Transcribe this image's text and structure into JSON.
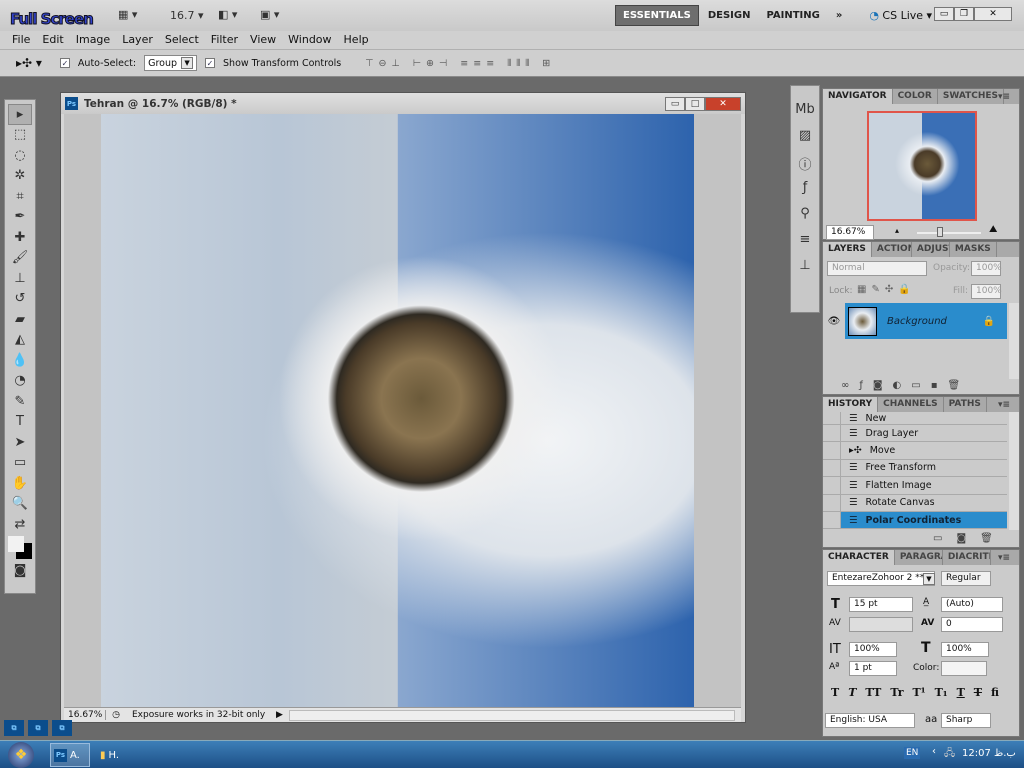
{
  "appbar": {
    "overlay_text": "Full Screen",
    "zoom": "16.7",
    "workspaces": [
      "ESSENTIALS",
      "DESIGN",
      "PAINTING"
    ],
    "more": "»",
    "cslive": "CS Live"
  },
  "menu": [
    "File",
    "Edit",
    "Image",
    "Layer",
    "Select",
    "Filter",
    "View",
    "Window",
    "Help"
  ],
  "options": {
    "auto_select_label": "Auto-Select:",
    "auto_select_value": "Group",
    "show_transform": "Show Transform Controls"
  },
  "document": {
    "title": "Tehran @ 16.7% (RGB/8) *",
    "zoom": "16.67%",
    "status": "Exposure works in 32-bit only"
  },
  "navigator": {
    "tabs": [
      "NAVIGATOR",
      "COLOR",
      "SWATCHES"
    ],
    "zoom": "16.67%"
  },
  "layers": {
    "tabs": [
      "LAYERS",
      "ACTIONS",
      "ADJUSTMENTS",
      "MASKS"
    ],
    "blend": "Normal",
    "opacity_label": "Opacity:",
    "opacity": "100%",
    "lock_label": "Lock:",
    "fill_label": "Fill:",
    "fill": "100%",
    "items": [
      {
        "name": "Background"
      }
    ]
  },
  "history": {
    "tabs": [
      "HISTORY",
      "CHANNELS",
      "PATHS"
    ],
    "items": [
      "New",
      "Drag Layer",
      "Move",
      "Free Transform",
      "Flatten Image",
      "Rotate Canvas",
      "Polar Coordinates"
    ]
  },
  "character": {
    "tabs": [
      "CHARACTER",
      "PARAGRAPH",
      "DIACRITIC"
    ],
    "font": "EntezareZohoor 2 **",
    "style": "Regular",
    "size": "15 pt",
    "leading": "(Auto)",
    "kerning": "",
    "tracking": "0",
    "vscale": "100%",
    "hscale": "100%",
    "baseline": "1 pt",
    "color_label": "Color:",
    "language": "English: USA",
    "aa_label": "aa",
    "antialias": "Sharp",
    "styles": [
      "T",
      "T",
      "TT",
      "Tr",
      "T¹",
      "T₁",
      "T",
      "T",
      "fi"
    ]
  },
  "taskbar": {
    "items": [
      "A.",
      "H."
    ],
    "lang": "EN",
    "time": "12:07 ب.ظ"
  }
}
